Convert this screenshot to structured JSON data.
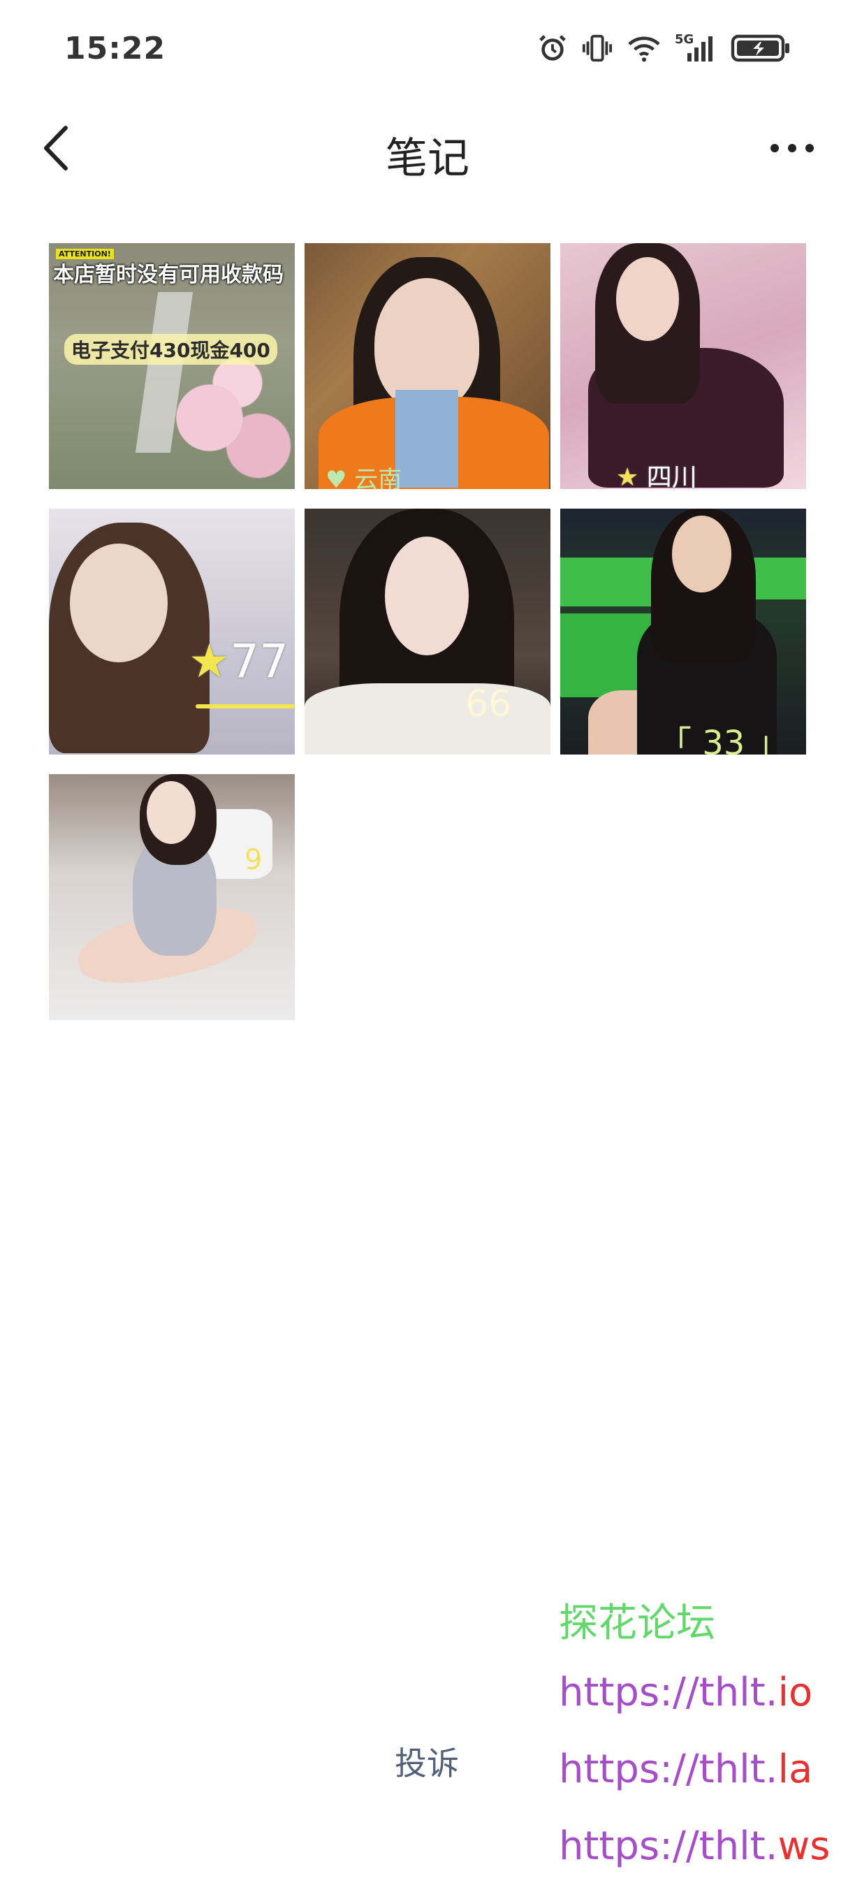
{
  "status_bar": {
    "time": "15:22",
    "icons": [
      "alarm-icon",
      "vibrate-icon",
      "wifi-icon",
      "signal-5g-icon",
      "battery-charging-icon"
    ],
    "network_label": "5G"
  },
  "nav": {
    "title": "笔记",
    "back_icon": "chevron-left-icon",
    "more_icon": "more-horizontal-icon"
  },
  "photos": [
    {
      "badge": "ATTENTION!",
      "headline": "本店暂时没有可用收款码",
      "overlay": "电子支付430现金400"
    },
    {
      "overlay": "♥ 云南"
    },
    {
      "star": "★",
      "overlay": "四川"
    },
    {
      "star": "★",
      "overlay": "77"
    },
    {
      "overlay": "66"
    },
    {
      "overlay": "「 33 」"
    },
    {
      "overlay": "9"
    }
  ],
  "footer": {
    "report_label": "投诉",
    "promo_title": "探花论坛",
    "urls": [
      {
        "base": "https://thlt.",
        "tld": "io"
      },
      {
        "base": "https://thlt.",
        "tld": "la"
      },
      {
        "base": "https://thlt.",
        "tld": "ws"
      }
    ]
  },
  "colors": {
    "promo_title": "#63d86a",
    "promo_url": "#a54ec8",
    "promo_tld": "#e83030",
    "report_link": "#536079"
  }
}
